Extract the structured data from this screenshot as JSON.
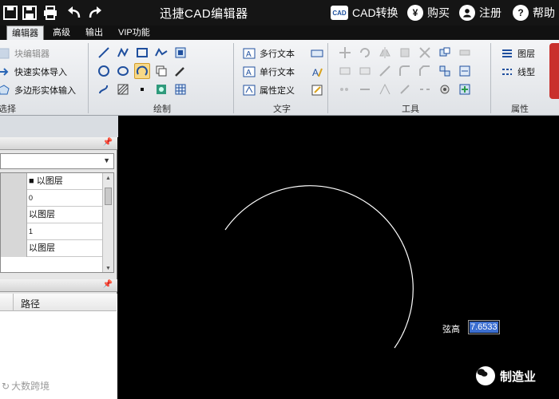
{
  "app": {
    "title": "迅捷CAD编辑器"
  },
  "title_actions": [
    {
      "label": "CAD转换",
      "icon": "cad-icon",
      "badge": "CAD"
    },
    {
      "label": "购买",
      "icon": "yen-icon",
      "badge": "¥"
    },
    {
      "label": "注册",
      "icon": "user-icon",
      "badge": "👤"
    },
    {
      "label": "帮助",
      "icon": "help-icon",
      "badge": "?"
    }
  ],
  "menu": {
    "tabs": [
      "编辑器",
      "高级",
      "输出",
      "VIP功能"
    ],
    "active": 0
  },
  "ribbon": {
    "select_group": {
      "label": "选择",
      "items": [
        "块编辑器",
        "快速实体导入",
        "多边形实体输入"
      ]
    },
    "draw_group": {
      "label": "绘制"
    },
    "text_group": {
      "label": "文字",
      "items": [
        "多行文本",
        "单行文本",
        "属性定义"
      ]
    },
    "tools_group": {
      "label": "工具"
    },
    "props_group": {
      "label": "属性",
      "items": [
        "图层",
        "线型"
      ]
    }
  },
  "left_panel": {
    "properties": [
      {
        "value": "■ 以图层"
      },
      {
        "value": "0"
      },
      {
        "value": "以图层"
      },
      {
        "value": "1"
      },
      {
        "value": "以图层"
      }
    ],
    "list_header": {
      "path_column": "路径"
    },
    "watermark": "大数跨境"
  },
  "canvas": {
    "dimension_label": "弦高",
    "dimension_value": "7.6533",
    "brand": "制造业"
  },
  "colors": {
    "titlebar": "#151515",
    "accent_selection": "#3c6fd0",
    "canvas": "#000000"
  }
}
